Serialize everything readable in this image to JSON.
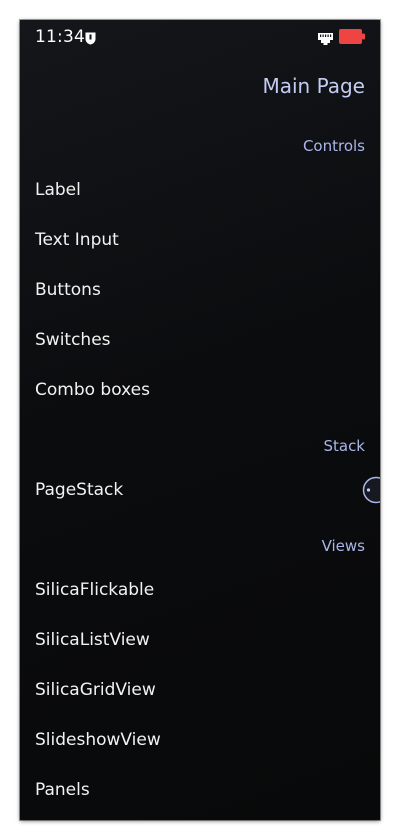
{
  "status_bar": {
    "time": "11:34",
    "icons": [
      "shield-icon",
      "ethernet-icon",
      "battery-icon"
    ],
    "battery_color": "#ef4444"
  },
  "page": {
    "title": "Main Page"
  },
  "sections": {
    "controls": {
      "header": "Controls",
      "items": [
        "Label",
        "Text Input",
        "Buttons",
        "Switches",
        "Combo boxes"
      ]
    },
    "stack": {
      "header": "Stack",
      "items": [
        "PageStack"
      ]
    },
    "views": {
      "header": "Views",
      "items": [
        "SilicaFlickable",
        "SilicaListView",
        "SilicaGridView",
        "SlideshowView",
        "Panels"
      ]
    }
  },
  "colors": {
    "background": "#0b0c0e",
    "header": "#c4ccf4",
    "section_header": "#aab6ea",
    "item_text": "#f2f2f2"
  }
}
